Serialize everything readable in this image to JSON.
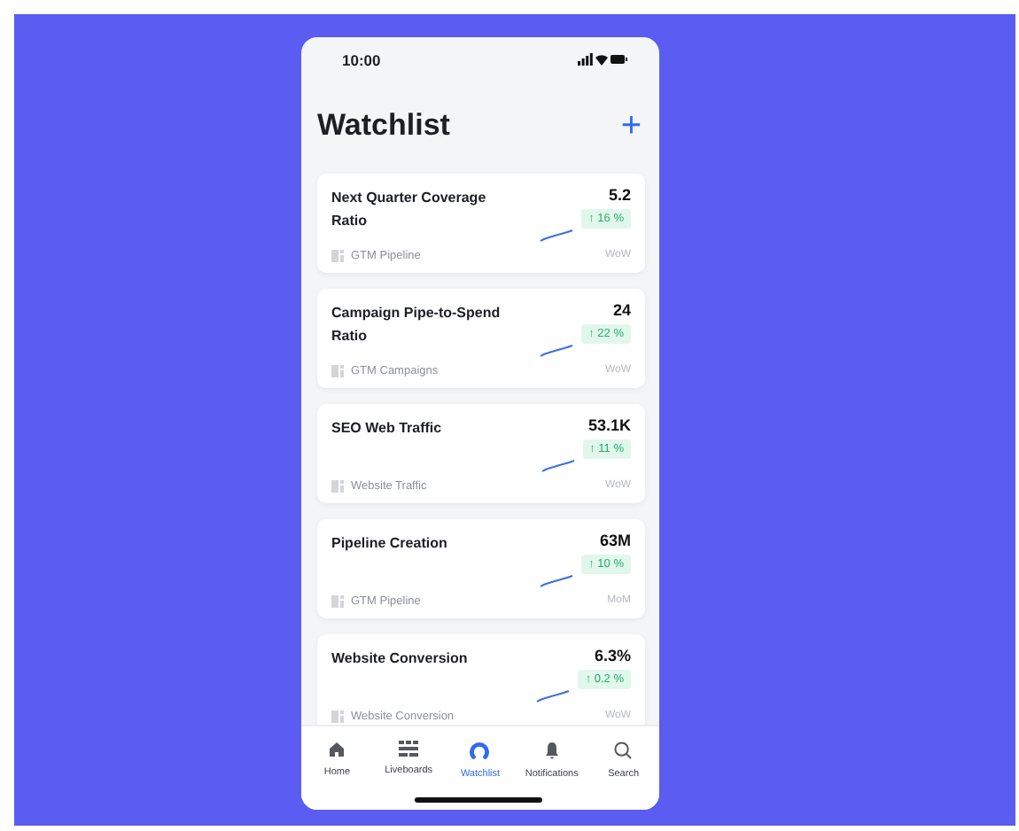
{
  "status_bar": {
    "time": "10:00"
  },
  "header": {
    "title": "Watchlist",
    "add_icon": "+"
  },
  "cards": [
    {
      "title": "Next Quarter Coverage Ratio",
      "value": "5.2",
      "change": "↑ 16 %",
      "source": "GTM Pipeline",
      "period": "WoW"
    },
    {
      "title": "Campaign Pipe-to-Spend Ratio",
      "value": "24",
      "change": "↑ 22 %",
      "source": "GTM Campaigns",
      "period": "WoW"
    },
    {
      "title": "SEO Web Traffic",
      "value": "53.1K",
      "change": "↑ 11 %",
      "source": "Website Traffic",
      "period": "WoW"
    },
    {
      "title": "Pipeline Creation",
      "value": "63M",
      "change": "↑ 10 %",
      "source": "GTM Pipeline",
      "period": "MoM"
    },
    {
      "title": "Website Conversion",
      "value": "6.3%",
      "change": "↑ 0.2 %",
      "source": "Website Conversion",
      "period": "WoW"
    }
  ],
  "tab_bar": [
    {
      "label": "Home",
      "kind": "home",
      "selected": false
    },
    {
      "label": "Liveboards",
      "kind": "boards",
      "selected": false
    },
    {
      "label": "Watchlist",
      "kind": "watch",
      "selected": true
    },
    {
      "label": "Notifications",
      "kind": "bell",
      "selected": false
    },
    {
      "label": "Search",
      "kind": "search",
      "selected": false
    }
  ]
}
